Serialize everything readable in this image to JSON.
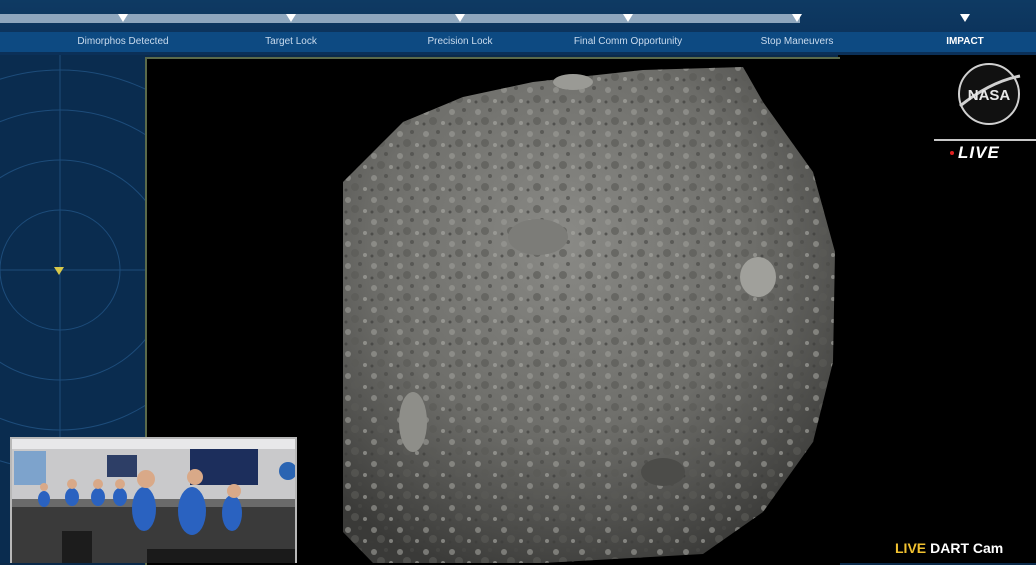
{
  "timeline": {
    "milestones": [
      {
        "label": "Dimorphos Detected",
        "active": false
      },
      {
        "label": "Target Lock",
        "active": false
      },
      {
        "label": "Precision Lock",
        "active": false
      },
      {
        "label": "Final Comm Opportunity",
        "active": false
      },
      {
        "label": "Stop Maneuvers",
        "active": false
      },
      {
        "label": "IMPACT",
        "active": true
      }
    ]
  },
  "broadcast": {
    "logo": "NASA",
    "live_label": "LIVE",
    "camera_live": "LIVE",
    "camera_name": "DART Cam"
  },
  "icons": {
    "nasa_logo": "nasa-meatball-icon",
    "marker": "triangle-down-icon",
    "radar_marker": "triangle-down-icon"
  },
  "colors": {
    "timeline_bg": "#0b3058",
    "label_bar": "#0d4a82",
    "live_yellow": "#f2c230",
    "live_dot": "#e02020"
  }
}
